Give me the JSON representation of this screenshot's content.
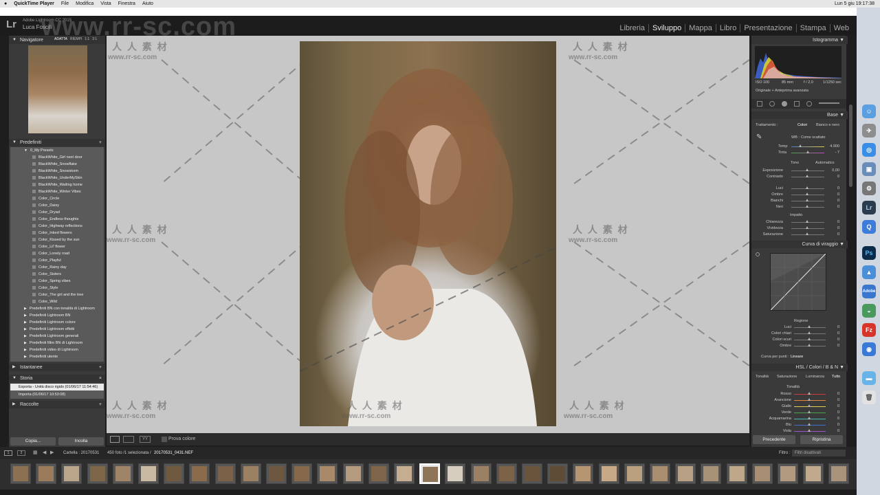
{
  "menubar": {
    "apple": "",
    "app": "QuickTime Player",
    "items": [
      "File",
      "Modifica",
      "Vista",
      "Finestra",
      "Aiuto"
    ],
    "clock": "Lun 5 giu 19:17:38"
  },
  "lr": {
    "logo": "Lr",
    "version": "Adobe Lightroom CC 2015",
    "user": "Luca Foscili",
    "watermark_url": "www.rr-sc.com"
  },
  "modules": [
    "Libreria",
    "Sviluppo",
    "Mappa",
    "Libro",
    "Presentazione",
    "Stampa",
    "Web"
  ],
  "active_module": "Sviluppo",
  "left": {
    "navigator": {
      "title": "Navigatore",
      "options": [
        "ADATTA",
        "RIEMPI",
        "1:1",
        "3:1"
      ]
    },
    "presets": {
      "title": "Predefiniti",
      "add": "+",
      "folder": "0_My Presets",
      "items": [
        "BlackWhite_Girl next door",
        "BlackWhite_Snowflake",
        "BlackWhite_Snowstorm",
        "BlackWhite_UnderMySkin",
        "BlackWhite_Waiting home",
        "BlackWhite_Winter Vibes",
        "Color_Circle",
        "Color_Daisy",
        "Color_Dryad",
        "Color_Endless thoughts",
        "Color_Highway reflections",
        "Color_Inked flowers",
        "Color_Kissed by the sun",
        "Color_Lil' flower",
        "Color_Lonely road",
        "Color_Playful",
        "Color_Rainy day",
        "Color_Sisters",
        "Color_Spring vibes",
        "Color_Style",
        "Color_The girl and the tree",
        "Color_Wild"
      ],
      "folders": [
        "Predefiniti BN con tonalità di Lightroom",
        "Predefiniti Lightroom BN",
        "Predefiniti Lightroom colore",
        "Predefiniti Lightroom effetti",
        "Predefiniti Lightroom generali",
        "Predefiniti filtro BN di Lightroom",
        "Predefiniti video di Lightroom",
        "Predefiniti utente"
      ]
    },
    "snapshots": {
      "title": "Istantanee",
      "add": "+"
    },
    "history": {
      "title": "Storia",
      "close": "×",
      "items": [
        "Esporta - Unità disco rigido (01/06/17 11:54:46)",
        "Importa (01/06/17 10:53:08)"
      ]
    },
    "collections": {
      "title": "Raccolte",
      "add": "+"
    },
    "copy_button": "Copia...",
    "paste_button": "Incolla"
  },
  "toolbar": {
    "label": "Prova colore"
  },
  "right": {
    "histogram": {
      "title": "Istogramma",
      "iso": "ISO 100",
      "focal": "85 mm",
      "aperture": "f / 2,0",
      "shutter": "1/1250 sec",
      "original": "Originale + Anteprima avanzata"
    },
    "basic": {
      "title": "Base",
      "treatment_label": "Trattamento :",
      "color": "Colori",
      "bw": "Bianco e nero",
      "wb_label": "WB :",
      "wb_value": "Come scattato",
      "temp_label": "Temp",
      "temp_value": "4.900",
      "tint_label": "Tinta",
      "tint_value": "- 7",
      "tone_label": "Tono",
      "auto": "Automatico",
      "exposure_label": "Esposizione",
      "exposure_value": "0,00",
      "contrast_label": "Contrasto",
      "contrast_value": "0",
      "highlights_label": "Luci",
      "highlights_value": "0",
      "shadows_label": "Ombre",
      "shadows_value": "0",
      "whites_label": "Bianchi",
      "whites_value": "0",
      "blacks_label": "Neri",
      "blacks_value": "0",
      "presence_label": "Impatto",
      "clarity_label": "Chiarezza",
      "clarity_value": "0",
      "vibrance_label": "Vividezza",
      "vibrance_value": "0",
      "saturation_label": "Saturazione",
      "saturation_value": "0"
    },
    "tonecurve": {
      "title": "Curva di viraggio",
      "region": "Regione",
      "lights": "Luci",
      "lightcolors": "Colori chiari",
      "darkcolors": "Colori scuri",
      "shadows": "Ombre",
      "v1": "0",
      "v2": "0",
      "v3": "0",
      "v4": "0",
      "pointcurve_label": "Curva per punti :",
      "pointcurve_value": "Lineare"
    },
    "hsl": {
      "title": "HSL / Colori / B & N",
      "tabs": [
        "Tonalità",
        "Saturazione",
        "Luminanza",
        "Tutto"
      ],
      "sub": "Tonalità",
      "rows": [
        "Rosso",
        "Arancione",
        "Giallo",
        "Verde",
        "Acquamarina",
        "Blu",
        "Viola"
      ],
      "vals": [
        "0",
        "0",
        "0",
        "0",
        "0",
        "0",
        "0"
      ]
    },
    "prev_button": "Precedente",
    "reset_button": "Ripristina"
  },
  "filmbar": {
    "folder": "Cartella : 20170531",
    "count": "450 foto /1 selezionata /",
    "file": "20170531_0431.NEF",
    "filter_label": "Filtro :",
    "filter_value": "Filtri disattivati"
  },
  "watermark": {
    "cn": "人 人 素 材",
    "url": "www.rr-sc.com"
  }
}
